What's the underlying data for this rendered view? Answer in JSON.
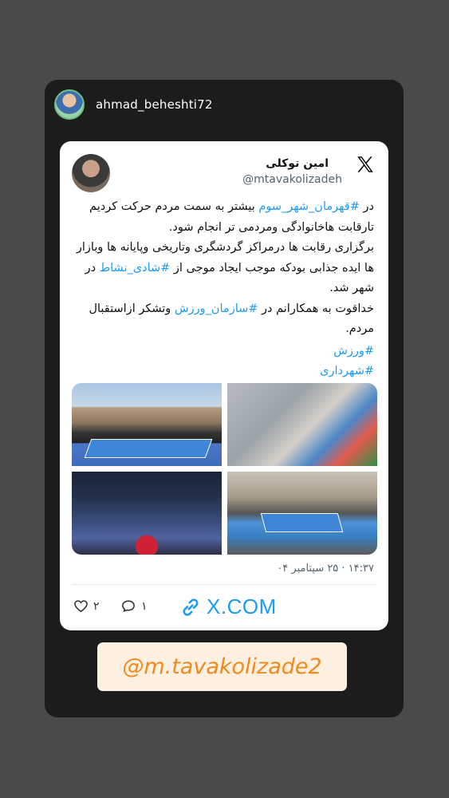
{
  "story": {
    "username": "ahmad_beheshti72"
  },
  "tweet": {
    "author_name": "امین توکلی",
    "author_handle": "@mtavakolizadeh",
    "body": {
      "p1_start": "در ",
      "p1_tag": "#قهرمان_شهر_سوم",
      "p1_rest": " بیشتر به سمت مردم حرکت کردیم تارقابت هاخانوادگی ومردمی تر انجام شود.",
      "p2_text": "برگزاری رقابت ها درمراکز گردشگری وتاریخی وپایانه ها وبازار ها ایده جذابی بودکه موجب ایجاد موجی از ",
      "p2_tag": "#شادی_نشاط",
      "p2_rest": " در شهر شد.",
      "p3_start": "خداقوت به همکارانم در ",
      "p3_tag": "#سازمان_ورزش",
      "p3_rest": " وتشکر ازاستقبال مردم.",
      "tag1": "#ورزش",
      "tag2": "#شهرداری"
    },
    "timestamp": "۱۴:۳۷ · ۲۵ سپتامبر ۰۴",
    "likes": "۲",
    "replies": "۱",
    "link": "X.COM"
  },
  "badge": {
    "handle": "@m.tavakolizade2"
  },
  "colors": {
    "accent": "#1d9bf0",
    "badge_text": "#f08a1c",
    "badge_bg": "#fdf0e1",
    "story_bg": "#1c1c1c",
    "page_bg": "#4a4a4a"
  },
  "icons": [
    "x-logo-icon",
    "heart-icon",
    "reply-bubble-icon",
    "link-icon"
  ]
}
